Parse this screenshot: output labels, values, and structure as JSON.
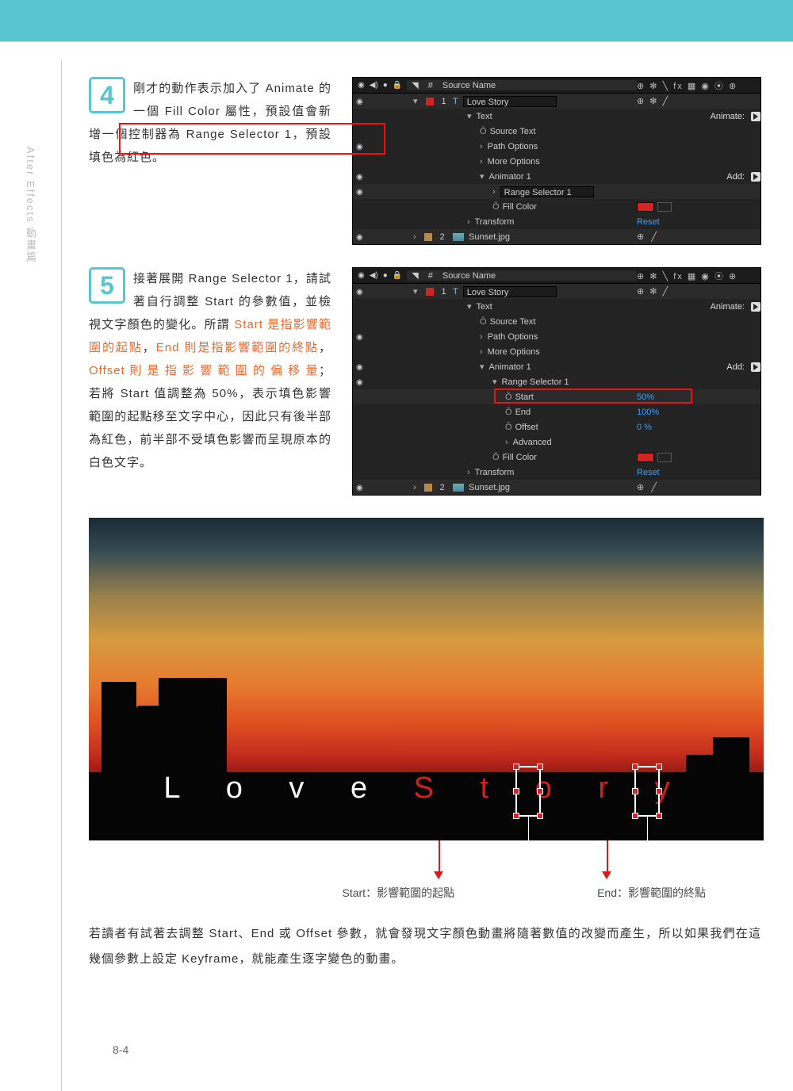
{
  "page": {
    "side_label": "After Effects 動畫篇",
    "number": "8-4"
  },
  "steps": {
    "s4": {
      "num": "4",
      "a": "剛才的動作表示加入了 Animate 的一個 Fill Color 屬性，預設值會新增一個控制器為 Range Selector 1，預設填色為紅色。"
    },
    "s5": {
      "num": "5",
      "a": "接著展開 Range Selector 1，請試著自行調整 Start 的參數值，並檢視文字顏色的變化。所謂 ",
      "o1": "Start 是指影響範圍的起點",
      "b": "，",
      "o2": "End 則是指影響範圍的終點",
      "c": "，",
      "o3": "Offset 則 是 指 影 響 範 圍 的 偏 移 量",
      "d": "；若將 Start 值調整為 50%，表示填色影響範圍的起點移至文字中心，因此只有後半部為紅色，前半部不受填色影響而呈現原本的白色文字。"
    }
  },
  "panelA": {
    "header_num_label": "#",
    "header_source": "Source Name",
    "layer1_num": "1",
    "layer1_name": "Love  Story",
    "text": "Text",
    "animate": "Animate:",
    "source_text": "Source Text",
    "path_options": "Path Options",
    "more_options": "More Options",
    "animator1": "Animator 1",
    "add": "Add:",
    "range_selector": "Range Selector 1",
    "fill_color": "Fill Color",
    "transform": "Transform",
    "reset": "Reset",
    "layer2_num": "2",
    "layer2_name": "Sunset.jpg"
  },
  "panelB": {
    "header_num_label": "#",
    "header_source": "Source Name",
    "layer1_num": "1",
    "layer1_name": "Love  Story",
    "text": "Text",
    "animate": "Animate:",
    "source_text": "Source Text",
    "path_options": "Path Options",
    "more_options": "More Options",
    "animator1": "Animator 1",
    "add": "Add:",
    "range_selector": "Range Selector 1",
    "start": "Start",
    "start_val": "50%",
    "end": "End",
    "end_val": "100%",
    "offset": "Offset",
    "offset_val": "0 %",
    "advanced": "Advanced",
    "fill_color": "Fill Color",
    "transform": "Transform",
    "reset": "Reset",
    "layer2_num": "2",
    "layer2_name": "Sunset.jpg"
  },
  "preview": {
    "t1": "L o v e",
    "spacer": " ",
    "t2": "S t o r y",
    "call_start": "Start：影響範圍的起點",
    "call_end": "End：影響範圍的終點"
  },
  "outro": "若讀者有試著去調整 Start、End 或 Offset 參數，就會發現文字顏色動畫將隨著數值的改變而產生，所以如果我們在這幾個參數上設定 Keyframe，就能產生逐字變色的動畫。"
}
